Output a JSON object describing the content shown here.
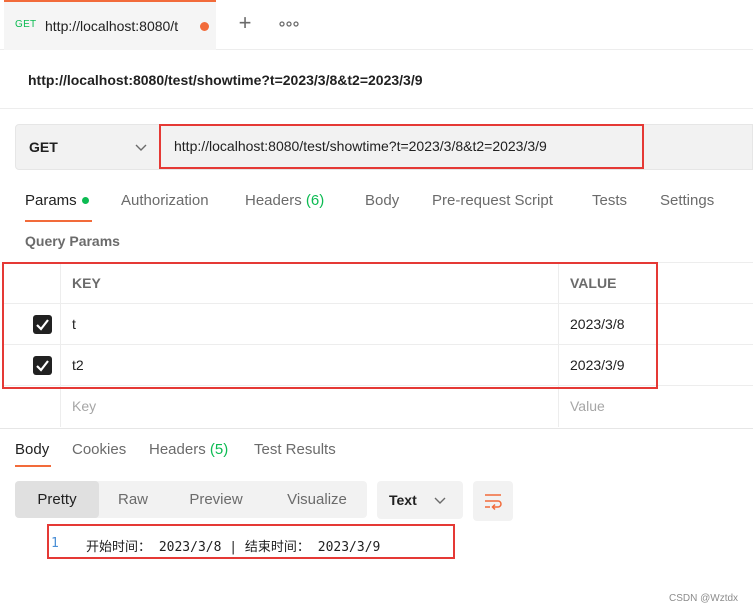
{
  "tab": {
    "method": "GET",
    "title": "http://localhost:8080/t"
  },
  "request": {
    "name": "http://localhost:8080/test/showtime?t=2023/3/8&t2=2023/3/9",
    "method": "GET",
    "url": "http://localhost:8080/test/showtime?t=2023/3/8&t2=2023/3/9"
  },
  "request_tabs": {
    "params": "Params",
    "authorization": "Authorization",
    "headers": "Headers",
    "headers_count": "(6)",
    "body": "Body",
    "prerequest": "Pre-request Script",
    "tests": "Tests",
    "settings": "Settings"
  },
  "query_params": {
    "title": "Query Params",
    "key_header": "KEY",
    "value_header": "VALUE",
    "rows": [
      {
        "key": "t",
        "value": "2023/3/8",
        "checked": true
      },
      {
        "key": "t2",
        "value": "2023/3/9",
        "checked": true
      }
    ],
    "key_placeholder": "Key",
    "value_placeholder": "Value"
  },
  "response_tabs": {
    "body": "Body",
    "cookies": "Cookies",
    "headers": "Headers",
    "headers_count": "(5)",
    "test_results": "Test Results"
  },
  "response_toolbar": {
    "pretty": "Pretty",
    "raw": "Raw",
    "preview": "Preview",
    "visualize": "Visualize",
    "format": "Text"
  },
  "response_body": {
    "line_number": "1",
    "line_text": "开始时间： 2023/3/8 | 结束时间： 2023/3/9"
  },
  "watermark": "CSDN @Wztdx",
  "colors": {
    "accent": "#f26b3a",
    "success": "#0cbb52",
    "highlight": "#e53935"
  }
}
